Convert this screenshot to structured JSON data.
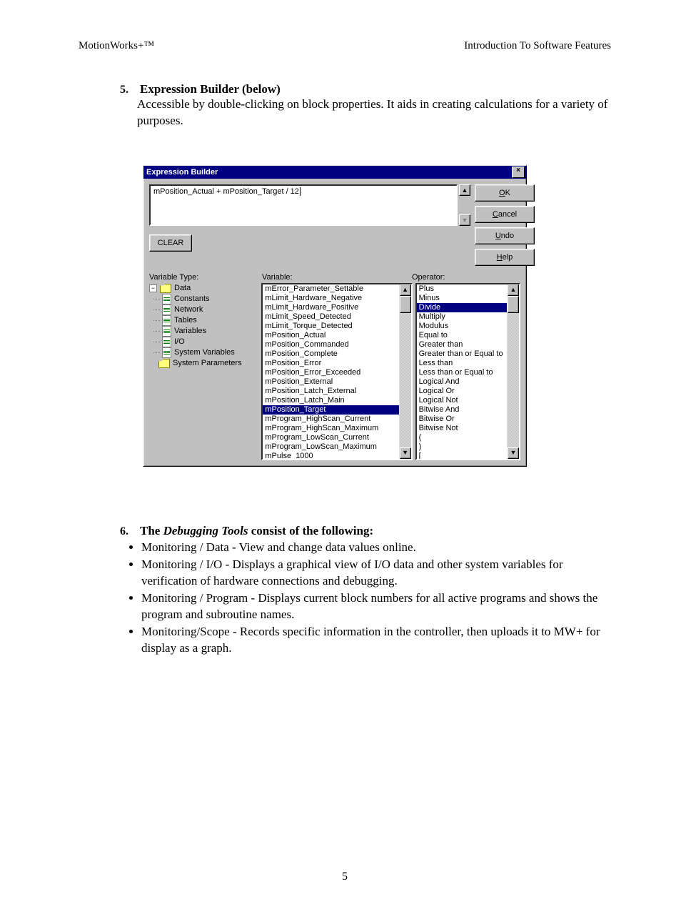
{
  "header": {
    "left": "MotionWorks+™",
    "right": "Introduction To Software Features"
  },
  "section5": {
    "num": "5.",
    "title": "Expression Builder (below)",
    "body": "Accessible by double-clicking on block properties.  It aids in creating calculations for a variety of purposes."
  },
  "dialog": {
    "title": "Expression Builder",
    "close": "×",
    "expression": "mPosition_Actual + mPosition_Target / 12",
    "buttons": {
      "ok": "OK",
      "cancel": "Cancel",
      "undo": "Undo",
      "help": "Help",
      "clear": "CLEAR"
    },
    "labels": {
      "variable_type": "Variable Type:",
      "variable": "Variable:",
      "operator": "Operator:"
    },
    "tree": {
      "root": "Data",
      "children": [
        "Constants",
        "Network",
        "Tables",
        "Variables",
        "I/O",
        "System Variables"
      ],
      "sibling": "System Parameters"
    },
    "variables": {
      "items": [
        "mError_Parameter_Settable",
        "mLimit_Hardware_Negative",
        "mLimit_Hardware_Positive",
        "mLimit_Speed_Detected",
        "mLimit_Torque_Detected",
        "mPosition_Actual",
        "mPosition_Commanded",
        "mPosition_Complete",
        "mPosition_Error",
        "mPosition_Error_Exceeded",
        "mPosition_External",
        "mPosition_Latch_External",
        "mPosition_Latch_Main",
        "mPosition_Target",
        "mProgram_HighScan_Current",
        "mProgram_HighScan_Maximum",
        "mProgram_LowScan_Current",
        "mProgram_LowScan_Maximum",
        "mPulse_1000"
      ],
      "selected_index": 13
    },
    "operators": {
      "items": [
        "Plus",
        "Minus",
        "Divide",
        "Multiply",
        "Modulus",
        "Equal to",
        "Greater than",
        "Greater than or Equal to",
        "Less than",
        "Less than or Equal to",
        "Logical And",
        "Logical Or",
        "Logical Not",
        "Bitwise And",
        "Bitwise Or",
        "Bitwise Not",
        "(",
        ")",
        "["
      ],
      "selected_index": 2
    }
  },
  "section6": {
    "num": "6.",
    "title_pre": "The ",
    "title_em": "Debugging Tools",
    "title_post": " consist of the following:",
    "bullets": [
      "Monitoring / Data - View and change data values online.",
      "Monitoring / I/O - Displays a graphical view of I/O data and other system variables for verification of hardware connections and debugging.",
      "Monitoring / Program - Displays current block numbers for all active programs and shows the program and subroutine names.",
      "Monitoring/Scope - Records specific information in the controller, then uploads it to MW+ for display as a graph."
    ]
  },
  "page_number": "5"
}
